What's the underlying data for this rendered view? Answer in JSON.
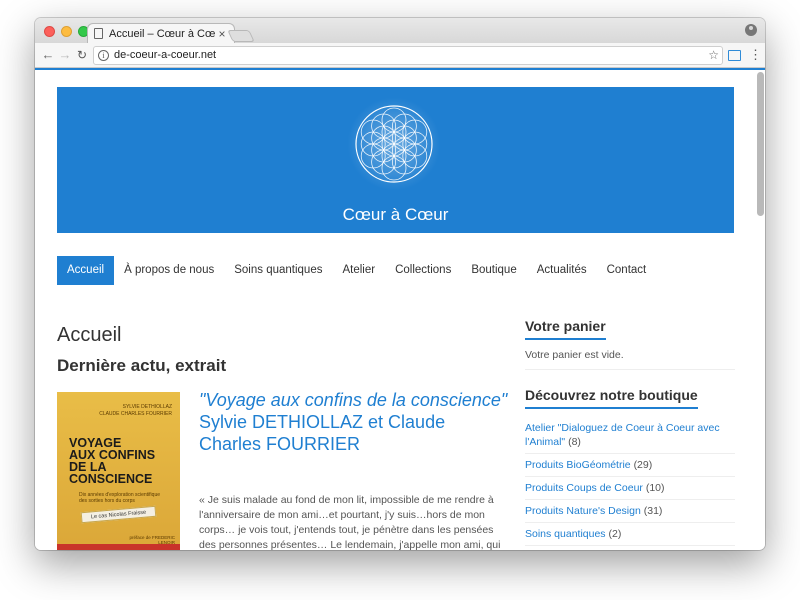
{
  "browser": {
    "tab_title": "Accueil – Cœur à Cœur",
    "tab_close": "×",
    "url": "de-coeur-a-coeur.net",
    "info_glyph": "i",
    "icons": {
      "back": "arrow-left-icon",
      "forward": "arrow-right-icon",
      "reload": "reload-icon",
      "bookmark": "star-icon",
      "cast": "cast-icon",
      "menu": "more-vertical-icon",
      "profile": "profile-icon"
    }
  },
  "site": {
    "title": "Cœur à Cœur",
    "accent_color": "#1f7fd1"
  },
  "nav": {
    "items": [
      {
        "label": "Accueil",
        "active": true
      },
      {
        "label": "À propos de nous",
        "active": false
      },
      {
        "label": "Soins quantiques",
        "active": false
      },
      {
        "label": "Atelier",
        "active": false
      },
      {
        "label": "Collections",
        "active": false
      },
      {
        "label": "Boutique",
        "active": false
      },
      {
        "label": "Actualités",
        "active": false
      },
      {
        "label": "Contact",
        "active": false
      }
    ]
  },
  "main": {
    "page_title": "Accueil",
    "section_title": "Dernière actu, extrait",
    "book": {
      "authors_line1": "SYLVIE DETHIOLLAZ",
      "authors_line2": "CLAUDE CHARLES FOURRIER",
      "title_line1": "VOYAGE",
      "title_line2": "AUX CONFINS",
      "title_line3": "DE LA CONSCIENCE",
      "subtitle": "Dix années d'exploration scientifique des sorties hors du corps",
      "label": "Le cas Nicolas Fraisse",
      "editor": "préface de FREDERIC LENOIR"
    },
    "article": {
      "quote_title": "\"Voyage aux confins de la conscience\"",
      "authors": "Sylvie DETHIOLLAZ et Claude Charles FOURRIER",
      "excerpt": "« Je suis malade au fond de mon lit, impossible de me rendre à l'anniversaire de mon ami…et pourtant, j'y suis…hors de mon corps… je vois tout, j'entends tout, je pénètre dans les pensées des personnes présentes… Le lendemain, j'appelle mon ami, qui me"
    }
  },
  "sidebar": {
    "cart_heading": "Votre panier",
    "cart_empty": "Votre panier est vide.",
    "shop_heading": "Découvrez notre boutique",
    "categories": [
      {
        "name": "Atelier \"Dialoguez de Coeur à Coeur avec l'Animal\"",
        "count": "(8)"
      },
      {
        "name": "Produits BioGéométrie",
        "count": "(29)"
      },
      {
        "name": "Produits Coups de Coeur",
        "count": "(10)"
      },
      {
        "name": "Produits Nature's Design",
        "count": "(31)"
      },
      {
        "name": "Soins quantiques",
        "count": "(2)"
      }
    ]
  }
}
